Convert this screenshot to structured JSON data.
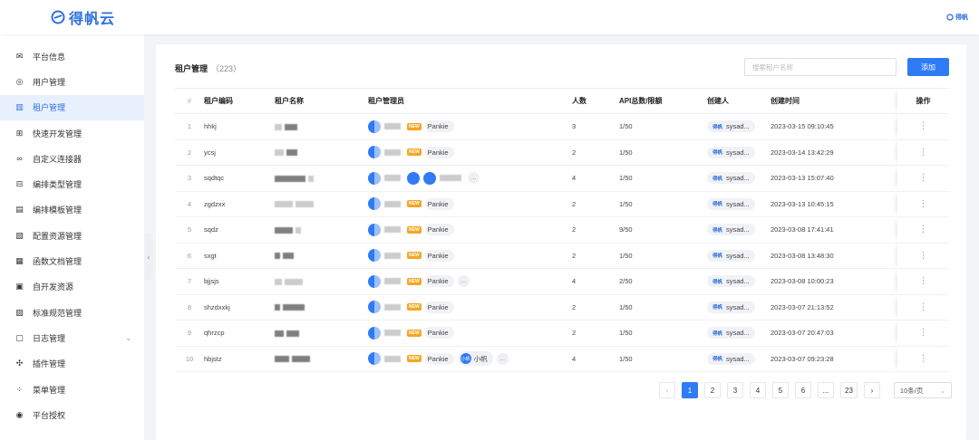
{
  "header": {
    "logo_text": "得帆云",
    "mini_logo_text": "得帆"
  },
  "sidebar": {
    "items": [
      {
        "label": "平台信息",
        "icon": "mail-icon"
      },
      {
        "label": "用户管理",
        "icon": "user-circle-icon"
      },
      {
        "label": "租户管理",
        "icon": "building-icon",
        "active": true
      },
      {
        "label": "快速开发管理",
        "icon": "grid-icon"
      },
      {
        "label": "自定义连接器",
        "icon": "link-icon"
      },
      {
        "label": "编排类型管理",
        "icon": "flow-icon"
      },
      {
        "label": "编排模板管理",
        "icon": "template-icon"
      },
      {
        "label": "配置资源管理",
        "icon": "file-gear-icon"
      },
      {
        "label": "函数文档管理",
        "icon": "chart-doc-icon"
      },
      {
        "label": "自开发资源",
        "icon": "window-icon"
      },
      {
        "label": "标准规范管理",
        "icon": "doc-check-icon"
      },
      {
        "label": "日志管理",
        "icon": "clipboard-icon",
        "expandable": true
      },
      {
        "label": "插件管理",
        "icon": "puzzle-icon"
      },
      {
        "label": "菜单管理",
        "icon": "menu-grid-icon"
      },
      {
        "label": "平台授权",
        "icon": "badge-icon"
      }
    ]
  },
  "main": {
    "title": "租户管理",
    "count": "（223）",
    "search_placeholder": "搜索租户名称",
    "add_label": "添加",
    "columns": {
      "num": "#",
      "code": "租户编码",
      "name": "租户名称",
      "admins": "租户管理员",
      "people": "人数",
      "api": "API总数/限额",
      "creator": "创建人",
      "created": "创建时间",
      "ops": "操作"
    },
    "rows": [
      {
        "num": "1",
        "code": "hhkj",
        "admin_name": "Pankie",
        "people": "3",
        "api": "1/50",
        "creator": "sysad...",
        "created": "2023-03-15 09:10:45"
      },
      {
        "num": "2",
        "code": "ycsj",
        "admin_name": "Pankie",
        "people": "2",
        "api": "1/50",
        "creator": "sysad...",
        "created": "2023-03-14 13:42:29"
      },
      {
        "num": "3",
        "code": "sqdtqc",
        "admin_name": "",
        "people": "4",
        "api": "1/50",
        "creator": "sysad...",
        "created": "2023-03-13 15:07:40"
      },
      {
        "num": "4",
        "code": "zgdzxx",
        "admin_name": "Pankie",
        "people": "2",
        "api": "1/50",
        "creator": "sysad...",
        "created": "2023-03-13 10:45:15"
      },
      {
        "num": "5",
        "code": "sqdz",
        "admin_name": "Pankie",
        "people": "2",
        "api": "9/50",
        "creator": "sysad...",
        "created": "2023-03-08 17:41:41"
      },
      {
        "num": "6",
        "code": "sxgt",
        "admin_name": "Pankie",
        "people": "2",
        "api": "1/50",
        "creator": "sysad...",
        "created": "2023-03-08 13:48:30"
      },
      {
        "num": "7",
        "code": "bjjsjs",
        "admin_name": "Pankie",
        "people": "4",
        "api": "2/50",
        "creator": "sysad...",
        "created": "2023-03-08 10:00:23"
      },
      {
        "num": "8",
        "code": "shzdxxkj",
        "admin_name": "Pankie",
        "people": "2",
        "api": "1/50",
        "creator": "sysad...",
        "created": "2023-03-07 21:13:52"
      },
      {
        "num": "9",
        "code": "qhrzcp",
        "admin_name": "Pankie",
        "people": "2",
        "api": "1/50",
        "creator": "sysad...",
        "created": "2023-03-07 20:47:03"
      },
      {
        "num": "10",
        "code": "hbjstz",
        "admin_name": "Pankie",
        "extra_admin": "小帆",
        "extra_avatar": "小帆",
        "people": "4",
        "api": "1/50",
        "creator": "sysad...",
        "created": "2023-03-07 09:23:28"
      }
    ],
    "new_tag": "NEW",
    "creator_logo": "得帆",
    "ellipsis": "..."
  },
  "pagination": {
    "pages": [
      "1",
      "2",
      "3",
      "4",
      "5",
      "6",
      "...",
      "23"
    ],
    "current": "1",
    "page_size": "10条/页"
  }
}
